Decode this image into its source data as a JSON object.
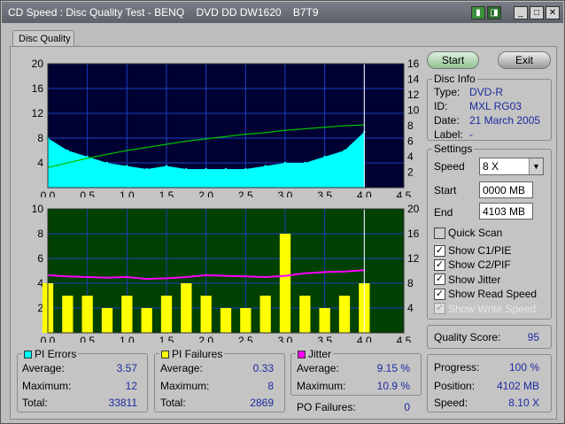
{
  "window": {
    "title": "CD Speed : Disc Quality Test - BENQ    DVD DD DW1620    B7T9"
  },
  "tab": "Disc Quality",
  "buttons": {
    "start": "Start",
    "exit": "Exit"
  },
  "disc_info": {
    "title": "Disc Info",
    "type_label": "Type:",
    "type": "DVD-R",
    "id_label": "ID:",
    "id": "MXL RG03",
    "date_label": "Date:",
    "date": "21 March 2005",
    "label_label": "Label:",
    "label": "-"
  },
  "settings": {
    "title": "Settings",
    "speed_label": "Speed",
    "speed": "8 X",
    "start_label": "Start",
    "start": "0000 MB",
    "end_label": "End",
    "end": "4103 MB",
    "quick_scan": "Quick Scan",
    "show_c1": "Show C1/PIE",
    "show_c2": "Show C2/PIF",
    "show_jitter": "Show Jitter",
    "show_read": "Show Read Speed",
    "show_write": "Show Write Speed"
  },
  "quality": {
    "label": "Quality Score:",
    "value": "95"
  },
  "progress": {
    "progress_label": "Progress:",
    "progress": "100 %",
    "position_label": "Position:",
    "position": "4102 MB",
    "speed_label": "Speed:",
    "speed": "8.10 X"
  },
  "pi_errors": {
    "title": "PI Errors",
    "average_label": "Average:",
    "average": "3.57",
    "maximum_label": "Maximum:",
    "maximum": "12",
    "total_label": "Total:",
    "total": "33811"
  },
  "pi_failures": {
    "title": "PI Failures",
    "average_label": "Average:",
    "average": "0.33",
    "maximum_label": "Maximum:",
    "maximum": "8",
    "total_label": "Total:",
    "total": "2869"
  },
  "jitter": {
    "title": "Jitter",
    "average_label": "Average:",
    "average": "9.15 %",
    "maximum_label": "Maximum:",
    "maximum": "10.9 %"
  },
  "po_failures": {
    "label": "PO Failures:",
    "value": "0"
  },
  "colors": {
    "pie": "#00ffff",
    "pif": "#ffff00",
    "jitter": "#ff00ff",
    "speed": "#00c000",
    "top_bg": "#000033",
    "bottom_bg": "#004000"
  },
  "chart_data": [
    {
      "type": "area",
      "series": [
        {
          "name": "PI Errors",
          "color": "#00ffff"
        }
      ],
      "xlim": [
        0,
        4.5
      ],
      "ylim": [
        0,
        20
      ],
      "y2lim": [
        0,
        16
      ],
      "xticks": [
        "0.0",
        "0.5",
        "1.0",
        "1.5",
        "2.0",
        "2.5",
        "3.0",
        "3.5",
        "4.0",
        "4.5"
      ],
      "yticks": [
        "20",
        "16",
        "12",
        "8",
        "4"
      ],
      "y2ticks": [
        "16",
        "14",
        "12",
        "10",
        "8",
        "6",
        "4",
        "2"
      ],
      "x": [
        0,
        0.25,
        0.5,
        0.75,
        1,
        1.25,
        1.5,
        1.75,
        2,
        2.25,
        2.5,
        2.75,
        3,
        3.25,
        3.5,
        3.75,
        4.0
      ],
      "pie": [
        8,
        6,
        5,
        4,
        3.5,
        3,
        3.5,
        3,
        3,
        3,
        3,
        3.5,
        4,
        4,
        5,
        6,
        9
      ],
      "speed": [
        2.6,
        3.2,
        3.8,
        4.3,
        4.8,
        5.2,
        5.6,
        6,
        6.3,
        6.6,
        6.9,
        7.1,
        7.4,
        7.6,
        7.8,
        8.0,
        8.1
      ]
    },
    {
      "type": "bar",
      "series": [
        {
          "name": "PI Failures",
          "color": "#ffff00"
        },
        {
          "name": "Jitter",
          "color": "#ff00ff"
        }
      ],
      "xlim": [
        0,
        4.5
      ],
      "ylim": [
        0,
        10
      ],
      "y2lim": [
        0,
        20
      ],
      "xticks": [
        "0.0",
        "0.5",
        "1.0",
        "1.5",
        "2.0",
        "2.5",
        "3.0",
        "3.5",
        "4.0",
        "4.5"
      ],
      "yticks": [
        "10",
        "8",
        "6",
        "4",
        "2"
      ],
      "y2ticks": [
        "20",
        "16",
        "12",
        "8",
        "4"
      ],
      "x": [
        0,
        0.25,
        0.5,
        0.75,
        1,
        1.25,
        1.5,
        1.75,
        2,
        2.25,
        2.5,
        2.75,
        3,
        3.25,
        3.5,
        3.75,
        4.0
      ],
      "pif": [
        4,
        3,
        3,
        2,
        3,
        2,
        3,
        4,
        3,
        2,
        2,
        3,
        8,
        3,
        2,
        3,
        4
      ],
      "jitter": [
        9.3,
        9.1,
        9.0,
        8.9,
        9.0,
        8.7,
        8.8,
        9.0,
        9.3,
        9.2,
        9.1,
        9.0,
        9.2,
        9.6,
        9.8,
        9.9,
        10.1
      ]
    }
  ]
}
